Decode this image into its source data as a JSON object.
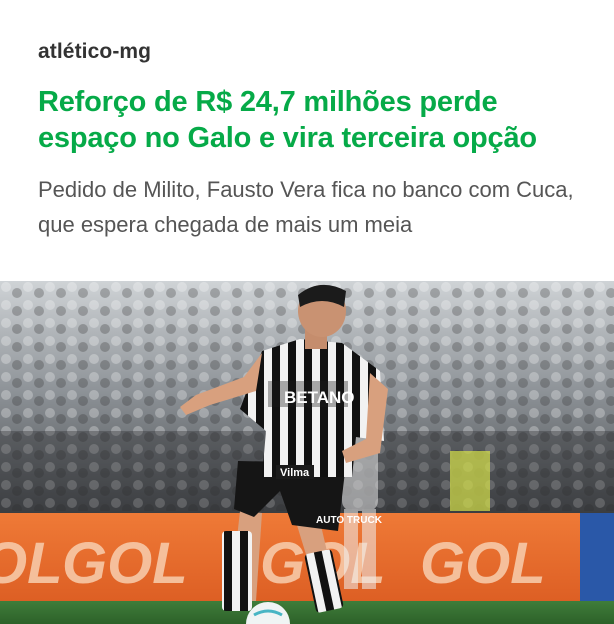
{
  "article": {
    "section": "atlético-mg",
    "headline": "Reforço de R$ 24,7 milhões perde espaço no Galo e vira terceira opção",
    "subheadline": "Pedido de Milito, Fausto Vera fica no banco com Cuca, que espera chegada de mais um meia"
  },
  "photo": {
    "board_text": "GOL",
    "jersey_sponsor": "BETANO",
    "shorts_sponsor": "AUTO TRUCK",
    "sleeve_sponsor": "Vilma"
  },
  "colors": {
    "headline_green": "#06aa48",
    "section_text": "#333333",
    "subheadline_text": "#555555",
    "board_orange": "#e8692c"
  }
}
